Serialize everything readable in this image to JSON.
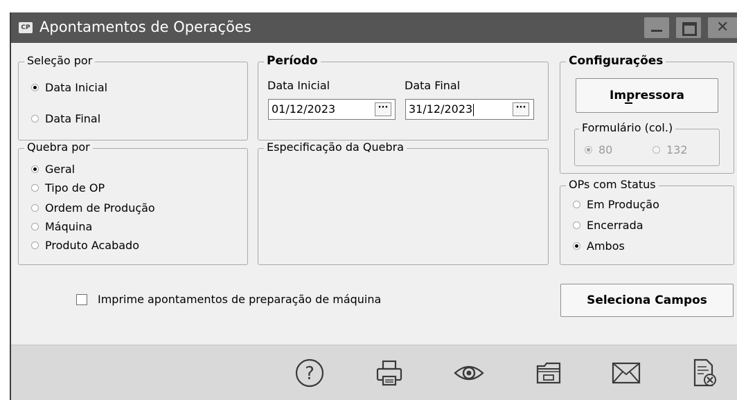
{
  "window": {
    "icon_label": "CP",
    "title": "Apontamentos de Operações"
  },
  "selecao": {
    "legend": "Seleção por",
    "options": [
      {
        "label": "Data Inicial",
        "checked": true
      },
      {
        "label": "Data Final",
        "checked": false
      }
    ]
  },
  "periodo": {
    "legend": "Período",
    "data_inicial_label": "Data Inicial",
    "data_inicial_value": "01/12/2023",
    "data_final_label": "Data Final",
    "data_final_value": "31/12/2023",
    "picker_label": "···"
  },
  "configuracoes": {
    "legend": "Configurações",
    "impressora_label": "Impressora",
    "formulario": {
      "legend": "Formulário (col.)",
      "options": [
        {
          "label": "80",
          "checked": true,
          "disabled": true
        },
        {
          "label": "132",
          "checked": false,
          "disabled": true
        }
      ]
    }
  },
  "quebra": {
    "legend": "Quebra por",
    "options": [
      {
        "label": "Geral",
        "checked": true
      },
      {
        "label": "Tipo de OP",
        "checked": false
      },
      {
        "label": "Ordem de Produção",
        "checked": false
      },
      {
        "label": "Máquina",
        "checked": false
      },
      {
        "label": "Produto Acabado",
        "checked": false
      }
    ]
  },
  "especificacao": {
    "legend": "Especificação da Quebra"
  },
  "status": {
    "legend": "OPs com Status",
    "options": [
      {
        "label": "Em Produção",
        "checked": false
      },
      {
        "label": "Encerrada",
        "checked": false
      },
      {
        "label": "Ambos",
        "checked": true
      }
    ]
  },
  "imprime_preparacao": {
    "label": "Imprime apontamentos de preparação de máquina",
    "checked": false
  },
  "seleciona_campos_label": "Seleciona Campos",
  "toolbar_icons": [
    "help-icon",
    "printer-icon",
    "preview-eye-icon",
    "folder-icon",
    "mail-icon",
    "document-close-icon"
  ]
}
